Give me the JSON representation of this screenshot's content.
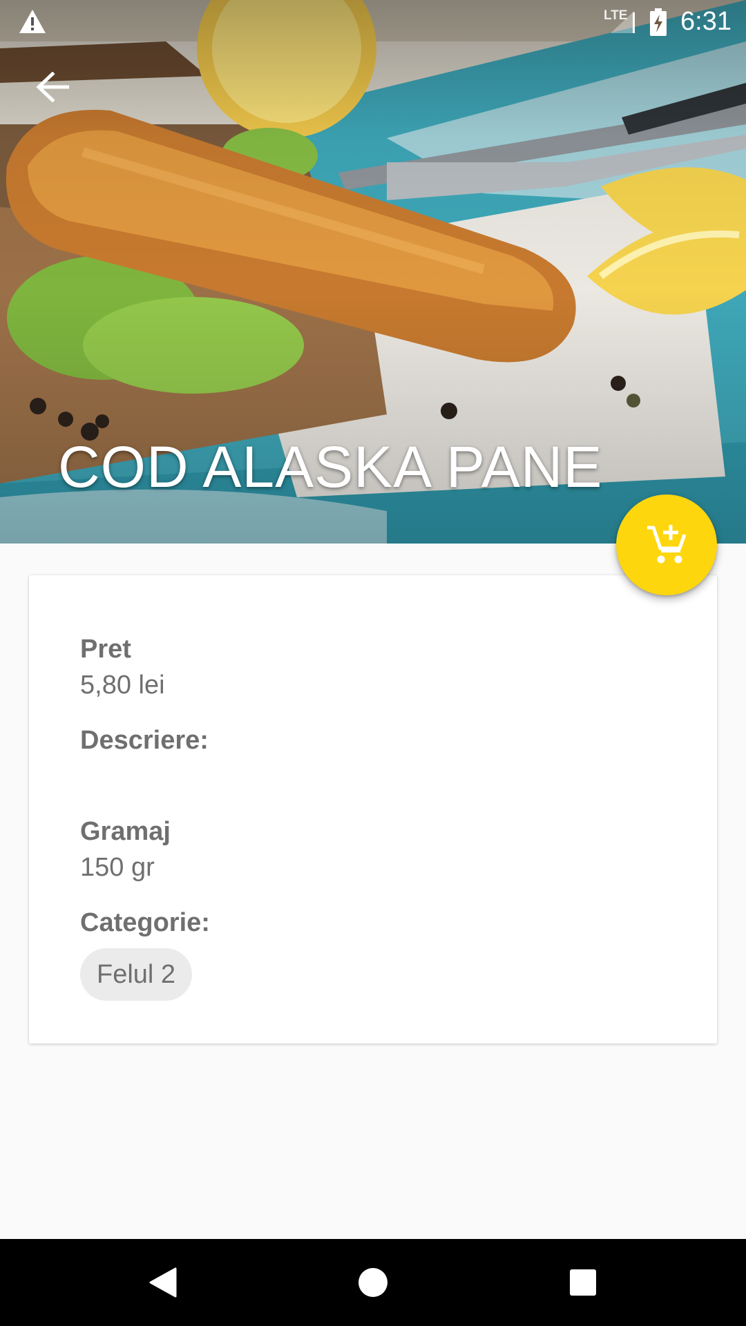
{
  "status_bar": {
    "network": "LTE",
    "time": "6:31"
  },
  "dish": {
    "title": "COD ALASKA PANE"
  },
  "details": {
    "price_label": "Pret",
    "price_value": "5,80 lei",
    "description_label": "Descriere:",
    "description_value": "",
    "weight_label": "Gramaj",
    "weight_value": "150 gr",
    "category_label": "Categorie:",
    "category_chip": "Felul 2"
  },
  "icons": {
    "warning": "warning-icon",
    "back": "arrow-back-icon",
    "fab": "add-shopping-cart-icon",
    "nav_back": "triangle-back-icon",
    "nav_home": "circle-home-icon",
    "nav_recents": "square-recents-icon"
  },
  "colors": {
    "accent": "#fdd60e",
    "text": "#6f6f6f",
    "chip_bg": "#ebebeb",
    "background": "#fafafa"
  }
}
